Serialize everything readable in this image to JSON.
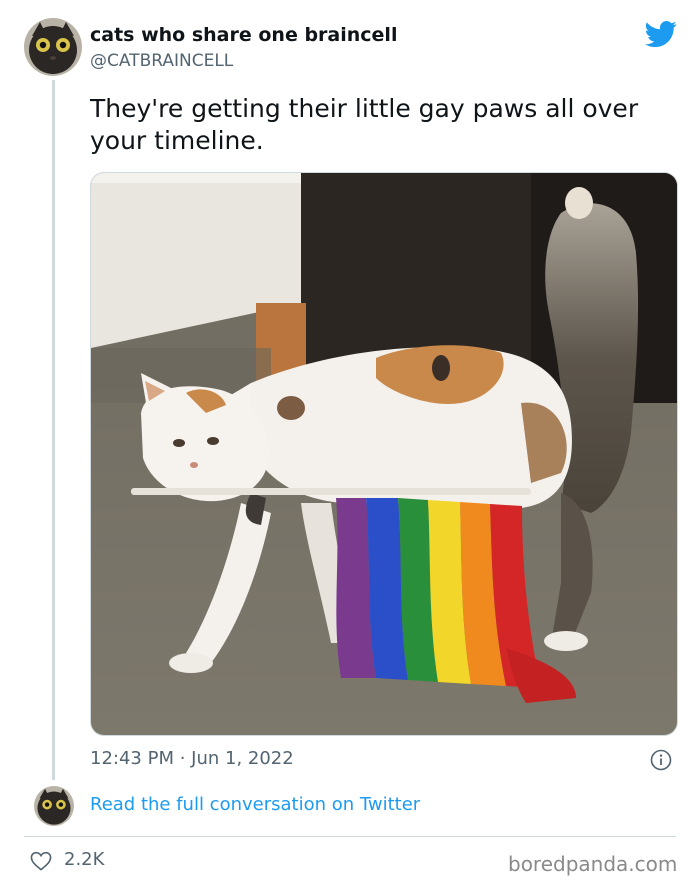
{
  "author": {
    "display_name": "cats who share one braincell",
    "handle": "@CATBRAINCELL"
  },
  "tweet": {
    "text": "They're getting their little gay paws all over your timeline.",
    "timestamp": "12:43 PM · Jun 1, 2022",
    "likes": "2.2K"
  },
  "conversation_link": "Read the full conversation on Twitter",
  "watermark": "boredpanda.com",
  "colors": {
    "link_blue": "#1d9bf0",
    "secondary_text": "#536471",
    "divider": "#cfd9de"
  },
  "icons": [
    "avatar",
    "twitter-bird-icon",
    "info-icon",
    "heart-icon"
  ]
}
